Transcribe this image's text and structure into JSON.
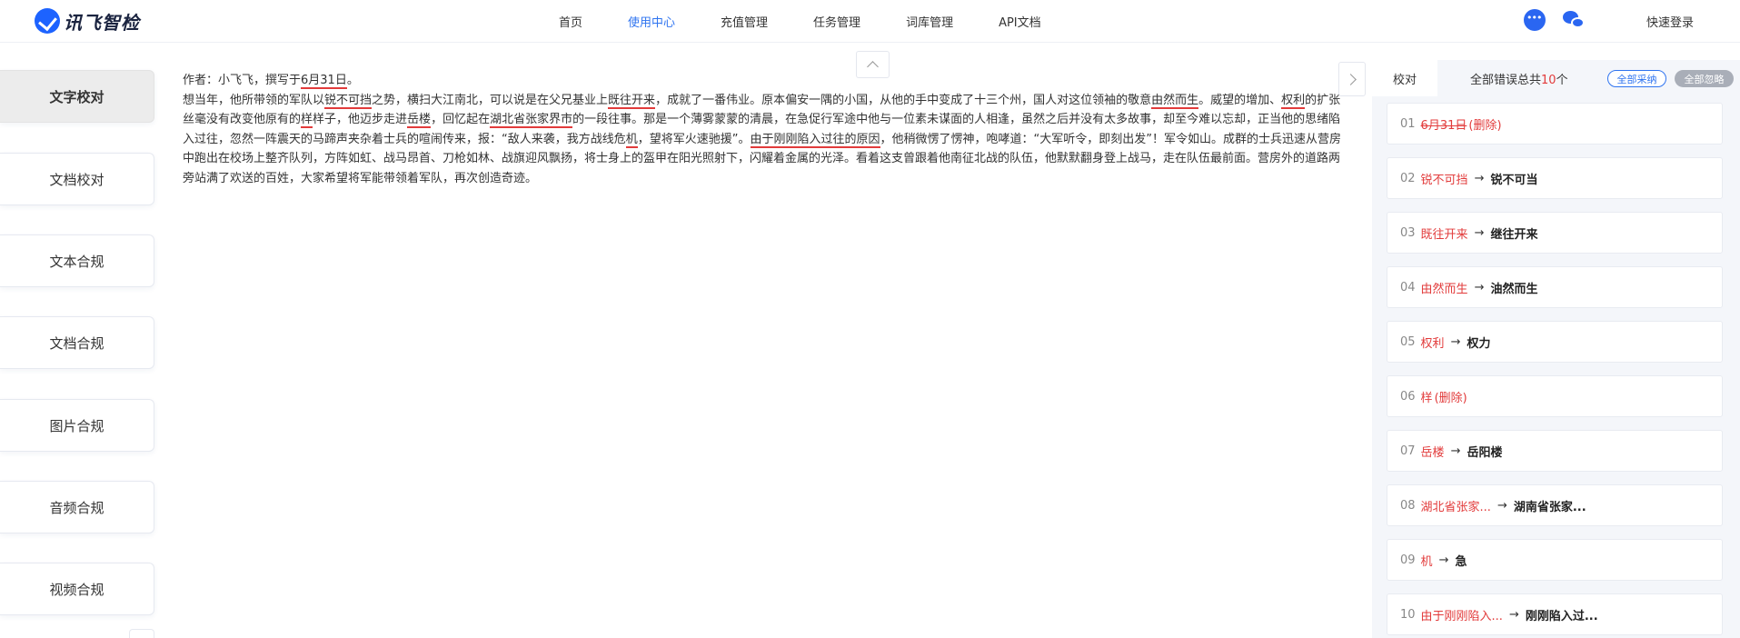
{
  "brand": {
    "name": "讯飞智检"
  },
  "nav": [
    {
      "label": "首页",
      "active": false
    },
    {
      "label": "使用中心",
      "active": true
    },
    {
      "label": "充值管理",
      "active": false
    },
    {
      "label": "任务管理",
      "active": false
    },
    {
      "label": "词库管理",
      "active": false
    },
    {
      "label": "API文档",
      "active": false
    }
  ],
  "header": {
    "login_label": "快速登录"
  },
  "sidebar": [
    {
      "label": "文字校对",
      "active": true
    },
    {
      "label": "文档校对"
    },
    {
      "label": "文本合规"
    },
    {
      "label": "文档合规"
    },
    {
      "label": "图片合规"
    },
    {
      "label": "音频合规"
    },
    {
      "label": "视频合规"
    }
  ],
  "document": {
    "segments": [
      {
        "t": "作者：小飞飞，撰写于"
      },
      {
        "t": "6月31日",
        "err": true
      },
      {
        "t": "。",
        "br": true
      },
      {
        "t": "想当年，他所带领的军队以"
      },
      {
        "t": "锐不可挡",
        "err": true
      },
      {
        "t": "之势，横扫大江南北，可以说是在父兄基业上"
      },
      {
        "t": "既往开来",
        "err": true
      },
      {
        "t": "，成就了一番伟业。原本偏安一隅的小国，从他的手中变成了十三个州，国人对这位领袖的敬意"
      },
      {
        "t": "由然而生",
        "err": true
      },
      {
        "t": "。威望的增加、"
      },
      {
        "t": "权利",
        "err": true
      },
      {
        "t": "的扩张丝毫没有改变他原有的"
      },
      {
        "t": "样",
        "err": true
      },
      {
        "t": "样子，他迈步走进"
      },
      {
        "t": "岳楼",
        "err": true
      },
      {
        "t": "，回忆起在"
      },
      {
        "t": "湖北省张家界市",
        "err": true
      },
      {
        "t": "的一段往事。那是一个薄雾蒙蒙的清晨，在急促行军途中他与一位素未谋面的人相逢，虽然之后并没有太多故事，却至今难以忘却，正当他的思绪陷入过往，忽然一阵震天的马蹄声夹杂着士兵的喧闹传来，报：“敌人来袭，我方战线危"
      },
      {
        "t": "机",
        "err": true
      },
      {
        "t": "，望将军火速驰援”。"
      },
      {
        "t": "由于刚刚陷入过往的原因",
        "err": true
      },
      {
        "t": "，他稍微愣了愣神，咆哮道：“大军听令，即刻出发”！军令如山。成群的士兵迅速从营房中跑出在校场上整齐队列，方阵如虹、战马昂首、刀枪如林、战旗迎风飘扬，将士身上的盔甲在阳光照射下，闪耀着金属的光泽。看着这支曾跟着他南征北战的队伍，他默默翻身登上战马，走在队伍最前面。营房外的道路两旁站满了欢送的百姓，大家希望将军能带领着军队，再次创造奇迹。"
      }
    ]
  },
  "panel": {
    "tab_label": "校对",
    "summary_prefix": "全部错误总共",
    "summary_count": "10",
    "summary_suffix": "个",
    "accept_all_label": "全部采纳",
    "ignore_all_label": "全部忽略",
    "corrections": [
      {
        "idx": "01",
        "wrong": "6月31日",
        "strike": true,
        "note": "(删除)",
        "right": ""
      },
      {
        "idx": "02",
        "wrong": "锐不可挡",
        "right": "锐不可当"
      },
      {
        "idx": "03",
        "wrong": "既往开来",
        "right": "继往开来"
      },
      {
        "idx": "04",
        "wrong": "由然而生",
        "right": "油然而生"
      },
      {
        "idx": "05",
        "wrong": "权利",
        "right": "权力"
      },
      {
        "idx": "06",
        "wrong": "样",
        "note": "(删除)",
        "right": ""
      },
      {
        "idx": "07",
        "wrong": "岳楼",
        "right": "岳阳楼"
      },
      {
        "idx": "08",
        "wrong": "湖北省张家...",
        "right": "湖南省张家..."
      },
      {
        "idx": "09",
        "wrong": "机",
        "right": "急"
      },
      {
        "idx": "10",
        "wrong": "由于刚刚陷入...",
        "right": "刚刚陷入过..."
      }
    ]
  }
}
